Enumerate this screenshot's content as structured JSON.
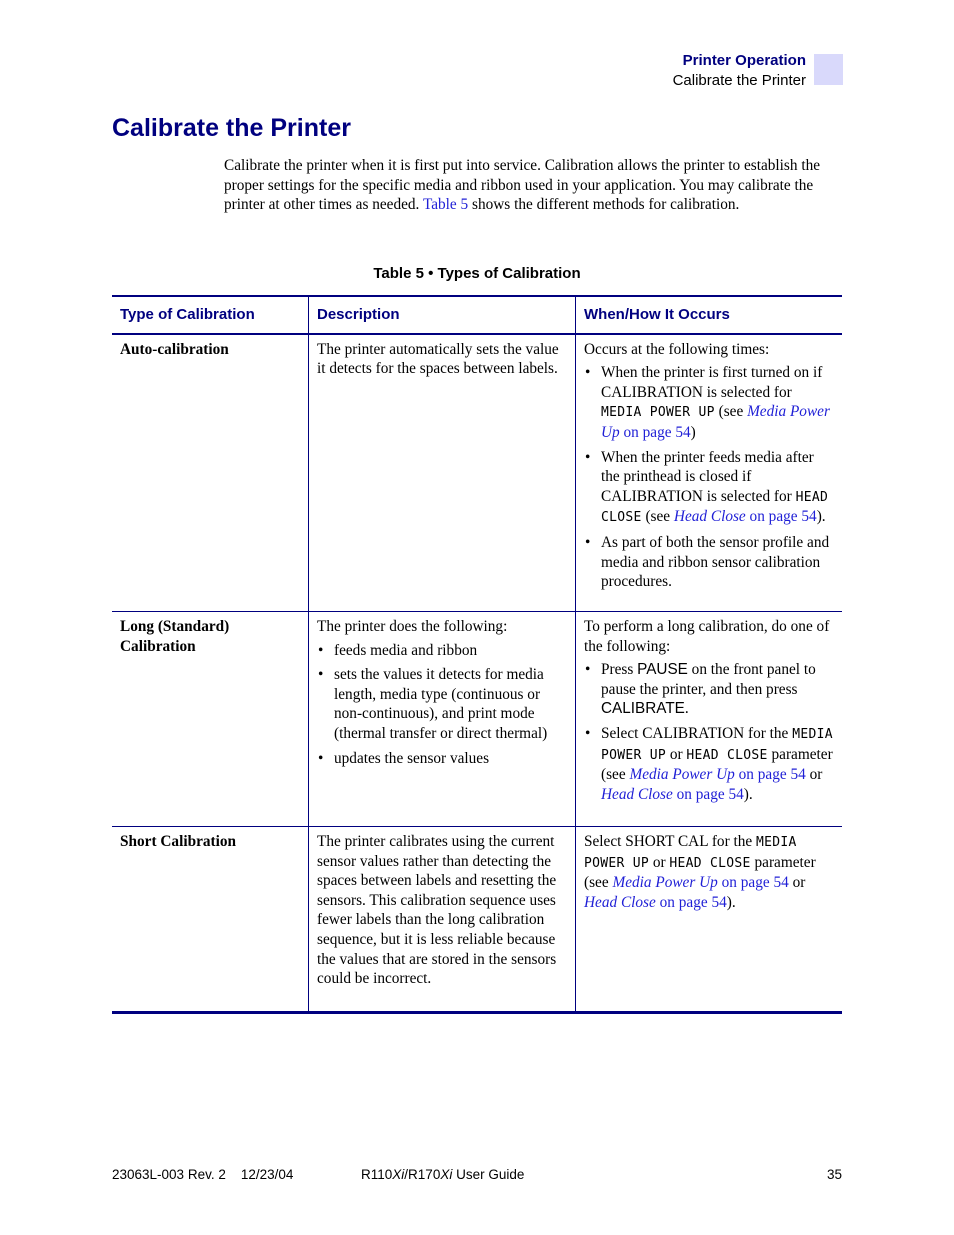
{
  "header": {
    "section": "Printer Operation",
    "subsection": "Calibrate the Printer",
    "tab_color": "#d9d9fb"
  },
  "page_title": "Calibrate the Printer",
  "intro": {
    "text_before_link": "Calibrate the printer when it is first put into service. Calibration allows the printer to establish the proper settings for the specific media and ribbon used in your application. You may calibrate the printer at other times as needed. ",
    "link": "Table 5",
    "text_after_link": " shows the different methods for calibration."
  },
  "table": {
    "caption": "Table 5 • Types of Calibration",
    "headers": [
      "Type of Calibration",
      "Description",
      "When/How It Occurs"
    ],
    "rows": [
      {
        "type": "Auto-calibration",
        "description": "The printer automatically sets the value it detects for the spaces between labels.",
        "when_intro": "Occurs at the following times:",
        "when_bullets": [
          {
            "t1": "When the printer is first turned on if CALIBRATION is selected for ",
            "code": "MEDIA POWER UP",
            "t2": " (see ",
            "link_i": "Media Power Up",
            "link": " on page 54",
            "t3": ")"
          },
          {
            "t1": "When the printer feeds media after the printhead is closed if CALIBRATION is selected for ",
            "code": "HEAD CLOSE",
            "t2": " (see ",
            "link_i": "Head Close",
            "link": " on page 54",
            "t3": ")."
          },
          {
            "t1": "As part of both the sensor profile and media and ribbon sensor calibration procedures."
          }
        ]
      },
      {
        "type": "Long (Standard) Calibration",
        "description_intro": "The printer does the following:",
        "description_bullets": [
          "feeds media and ribbon",
          "sets the values it detects for media length, media type (continuous or non-continuous), and print mode (thermal transfer or direct thermal)",
          "updates the sensor values"
        ],
        "when_intro": "To perform a long calibration, do one of the following:",
        "when_bullets": [
          {
            "t1": "Press ",
            "key1": "PAUSE",
            "t2": " on the front panel to pause the printer, and then press ",
            "key2": "CALIBRATE",
            "t3": "."
          },
          {
            "t1": "Select CALIBRATION for the ",
            "code1": "MEDIA POWER UP",
            "t2": " or ",
            "code2": "HEAD CLOSE",
            "t3": " parameter (see ",
            "link1_i": "Media Power Up",
            "link1": " on page 54",
            "t4": " or ",
            "link2_i": "Head Close",
            "link2": " on page 54",
            "t5": ")."
          }
        ]
      },
      {
        "type": "Short Calibration",
        "description": "The printer calibrates using the current sensor values rather than detecting the spaces between labels and resetting the sensors. This calibration sequence uses fewer labels than the long calibration sequence, but it is less reliable because the values that are stored in the sensors could be incorrect.",
        "when": {
          "t1": "Select SHORT CAL for the ",
          "code1": "MEDIA POWER UP",
          "t2": " or ",
          "code2": "HEAD CLOSE",
          "t3": " parameter (see ",
          "link1_i": "Media Power Up",
          "link1": " on page 54",
          "t4": " or ",
          "link2_i": "Head Close",
          "link2": " on page 54",
          "t5": ")."
        }
      }
    ]
  },
  "footer": {
    "doc_id": "23063L-003 Rev. 2    12/23/04",
    "guide_pre": "R110",
    "guide_i1": "Xi",
    "guide_mid": "/R170",
    "guide_i2": "Xi",
    "guide_post": " User Guide",
    "page_number": "35"
  }
}
